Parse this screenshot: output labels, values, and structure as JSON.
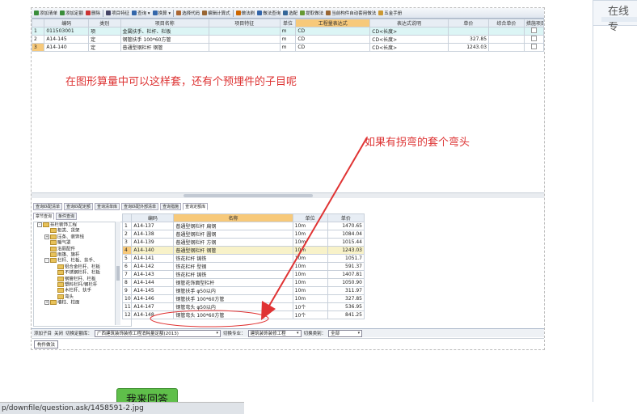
{
  "toolbar": {
    "buttons": [
      {
        "label": "添加清单",
        "icon": "add-list-icon"
      },
      {
        "label": "添加定额",
        "icon": "add-quota-icon"
      },
      {
        "label": "删除",
        "icon": "delete-icon"
      },
      {
        "label": "项目特征",
        "icon": "item-feature-icon"
      },
      {
        "label": "查询 ▾",
        "icon": "search-icon"
      },
      {
        "label": "换算 ▾",
        "icon": "convert-icon"
      },
      {
        "label": "选择代码",
        "icon": "select-code-icon"
      },
      {
        "label": "编辑计算式",
        "icon": "edit-formula-icon"
      },
      {
        "label": "做法刷",
        "icon": "brush-icon"
      },
      {
        "label": "做法查询",
        "icon": "method-query-icon"
      },
      {
        "label": "选配",
        "icon": "match-icon"
      },
      {
        "label": "提取做法",
        "icon": "extract-icon"
      },
      {
        "label": "当前构件自动套用做法",
        "icon": "auto-apply-icon"
      },
      {
        "label": "五金手册",
        "icon": "hardware-manual-icon"
      }
    ]
  },
  "top_grid": {
    "headers": [
      "",
      "编码",
      "类别",
      "项目名称",
      "项目特征",
      "单位",
      "工程量表达式",
      "表达式说明",
      "单价",
      "综合单价",
      "措施项目"
    ],
    "rows": [
      {
        "num": "1",
        "code": "011503001",
        "type": "项",
        "name": "金属扶手、栏杆、栏板",
        "feature": "",
        "unit": "m",
        "expr": "CD",
        "desc": "CD<长度>",
        "price": "",
        "total": ""
      },
      {
        "num": "2",
        "code": "A14-145",
        "type": "定",
        "name": "钢管扶手 100*60方管",
        "feature": "",
        "unit": "m",
        "expr": "CD",
        "desc": "CD<长度>",
        "price": "327.85",
        "total": ""
      },
      {
        "num": "3",
        "code": "A14-140",
        "type": "定",
        "name": "普通型钢栏杆 钢管",
        "feature": "",
        "unit": "m",
        "expr": "CD",
        "desc": "CD<长度>",
        "price": "1243.03",
        "total": ""
      }
    ]
  },
  "annotations": {
    "main": "在图形算量中可以这样套，还有个预埋件的子目呢",
    "bend": "如果有拐弯的套个弯头"
  },
  "lower_tabs": [
    "查询匹配清单",
    "查询匹配定额",
    "查询清单库",
    "查询匹配外部清单",
    "查询措施",
    "查询定额库"
  ],
  "lower_subtabs": [
    "章节查询",
    "条件查询"
  ],
  "tree": [
    {
      "label": "扶栏装饰工程",
      "level": 0,
      "exp": "-"
    },
    {
      "label": "柜类、货架",
      "level": 1,
      "exp": ""
    },
    {
      "label": "压条、装饰线",
      "level": 1,
      "exp": "+"
    },
    {
      "label": "暖气罩",
      "level": 1,
      "exp": ""
    },
    {
      "label": "浴厕配件",
      "level": 1,
      "exp": ""
    },
    {
      "label": "雨篷、旗杆",
      "level": 1,
      "exp": ""
    },
    {
      "label": "栏杆、栏板、扶手、",
      "level": 1,
      "exp": "-"
    },
    {
      "label": "铝合金栏杆、栏板",
      "level": 2,
      "exp": ""
    },
    {
      "label": "不锈钢栏杆、栏板",
      "level": 2,
      "exp": ""
    },
    {
      "label": "钢管栏杆、栏板",
      "level": 2,
      "exp": ""
    },
    {
      "label": "塑料栏杆/钢栏杆",
      "level": 2,
      "exp": ""
    },
    {
      "label": "木栏杆、扶手",
      "level": 2,
      "exp": ""
    },
    {
      "label": "弯头",
      "level": 2,
      "exp": ""
    },
    {
      "label": "墙柱、柱面",
      "level": 1,
      "exp": "+"
    }
  ],
  "lower_grid": {
    "headers": [
      "",
      "编码",
      "名称",
      "单位",
      "单价"
    ],
    "rows": [
      {
        "num": "1",
        "code": "A14-137",
        "name": "普通型钢栏杆 扁钢",
        "unit": "10m",
        "price": "1470.65"
      },
      {
        "num": "2",
        "code": "A14-138",
        "name": "普通型钢栏杆 圆钢",
        "unit": "10m",
        "price": "1084.04"
      },
      {
        "num": "3",
        "code": "A14-139",
        "name": "普通型钢栏杆 方钢",
        "unit": "10m",
        "price": "1015.44"
      },
      {
        "num": "4",
        "code": "A14-140",
        "name": "普通型钢栏杆 钢管",
        "unit": "10m",
        "price": "1243.03"
      },
      {
        "num": "5",
        "code": "A14-141",
        "name": "铁花栏杆 铸铁",
        "unit": "10m",
        "price": "1051.7"
      },
      {
        "num": "6",
        "code": "A14-142",
        "name": "铁花栏杆 型钢",
        "unit": "10m",
        "price": "591.37"
      },
      {
        "num": "7",
        "code": "A14-143",
        "name": "铁花栏杆 铸铁",
        "unit": "10m",
        "price": "1407.81"
      },
      {
        "num": "8",
        "code": "A14-144",
        "name": "钢管花饰面型栏杆",
        "unit": "10m",
        "price": "1050.90"
      },
      {
        "num": "9",
        "code": "A14-145",
        "name": "钢管扶手 φ50以内",
        "unit": "10m",
        "price": "311.97"
      },
      {
        "num": "10",
        "code": "A14-146",
        "name": "钢管扶手 100*60方管",
        "unit": "10m",
        "price": "327.85"
      },
      {
        "num": "11",
        "code": "A14-147",
        "name": "钢管弯头 φ50以内",
        "unit": "10个",
        "price": "536.95"
      },
      {
        "num": "12",
        "code": "A14-148",
        "name": "钢管弯头 100*60方管",
        "unit": "10个",
        "price": "841.25"
      }
    ]
  },
  "status_bar": {
    "add_sub": "添加子目",
    "close": "关闭",
    "switch_lib_label": "切换定额库：",
    "switch_lib_value": "广西建筑装饰装修工程消耗量定额(2013)",
    "switch_major_label": "切换专业：",
    "switch_major_value": "建筑装饰装修工程",
    "switch_type_label": "切换类别：",
    "switch_type_value": "全部"
  },
  "bottom_tab": "构件做法",
  "right_panel": {
    "title": "在线专"
  },
  "reply_button": "我来回答",
  "url_text": "p/downfile/question.ask/1458591-2.jpg",
  "colors": {
    "annotation_red": "#d33333",
    "reply_green": "#5fbf4a"
  }
}
